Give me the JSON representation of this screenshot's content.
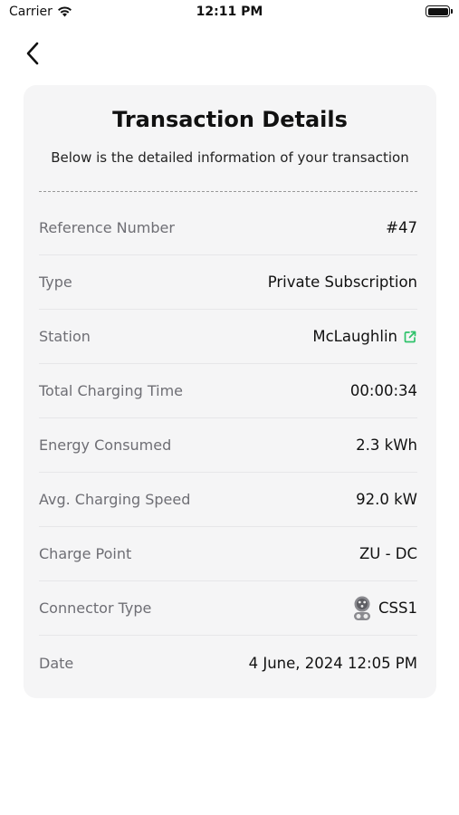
{
  "status_bar": {
    "carrier": "Carrier",
    "time": "12:11 PM"
  },
  "header": {
    "back_icon": "chevron-left-icon"
  },
  "card": {
    "title": "Transaction Details",
    "subtitle": "Below is the detailed information of your transaction",
    "rows": [
      {
        "label": "Reference Number",
        "value": "#47"
      },
      {
        "label": "Type",
        "value": "Private Subscription"
      },
      {
        "label": "Station",
        "value": "McLaughlin",
        "icon": "external-link-icon"
      },
      {
        "label": "Total Charging Time",
        "value": "00:00:34"
      },
      {
        "label": "Energy Consumed",
        "value": "2.3 kWh"
      },
      {
        "label": "Avg. Charging Speed",
        "value": "92.0 kW"
      },
      {
        "label": "Charge Point",
        "value": "ZU - DC"
      },
      {
        "label": "Connector Type",
        "value": "CSS1",
        "icon": "ccs1-connector-icon"
      },
      {
        "label": "Date",
        "value": "4 June, 2024 12:05 PM"
      }
    ]
  },
  "colors": {
    "card_background": "#f5f5f6",
    "label_text": "#6e6e74",
    "accent_green": "#2ec26a"
  }
}
